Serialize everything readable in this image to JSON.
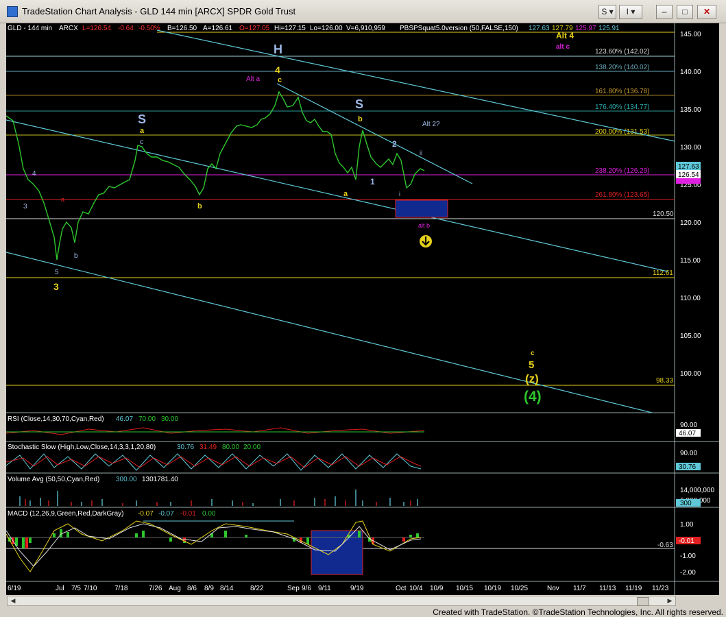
{
  "window": {
    "title": "TradeStation Chart Analysis - GLD 144 min [ARCX] SPDR Gold Trust",
    "btn_s": "S",
    "btn_i": "I"
  },
  "header": {
    "symbol": "GLD - 144 min",
    "exchange": "ARCX",
    "last": "L=126.54",
    "change": "-0.64",
    "pct": "-0.50%",
    "bid": "B=126.50",
    "ask": "A=126.61",
    "open": "O=127.05",
    "high": "Hi=127.15",
    "low": "Lo=126.00",
    "volume": "V=6,910,959",
    "indicator": "PBSPSquat5.0version (50,FALSE,150)",
    "vals": [
      "127.63",
      "127.79",
      "125.97",
      "125.91"
    ]
  },
  "price_axis": {
    "labels": [
      "145.00",
      "140.00",
      "135.00",
      "130.00",
      "125.00",
      "120.00",
      "115.00",
      "110.00",
      "105.00",
      "100.00"
    ]
  },
  "last_price_tags": {
    "top": "127.63",
    "last": "126.54",
    "under": "125.97"
  },
  "fib_levels": [
    "123.60% (142.02)",
    "138.20% (140.02)",
    "161.80% (136.78)",
    "176.40% (134.77)",
    "200.00% (131.53)",
    "238.20% (126.29)",
    "261.80% (123.65)"
  ],
  "levels": [
    "120.50",
    "112.61",
    "98.33"
  ],
  "wave_labels": {
    "H": "H",
    "four": "4",
    "c_top": "c",
    "alt_a": "Alt a",
    "S_left": "S",
    "a_left": "a",
    "c_left": "c",
    "S_right": "S",
    "b_right": "b",
    "two": "2",
    "alt2": "Alt 2?",
    "ii": "ii",
    "one": "1",
    "i_low": "i",
    "a_right": "a",
    "b_left": "b",
    "four_small": "4",
    "three_small": "3",
    "a_small": "a",
    "b_small": "b",
    "five_small": "5",
    "three_big": "3",
    "alt4": "Alt 4",
    "alt_c": "alt c",
    "alt_b": "alt b",
    "c_bottom": "c",
    "five_bottom": "5",
    "z": "(z)",
    "four_big": "(4)"
  },
  "panes": {
    "rsi": {
      "label": "RSI (Close,14,30,70,Cyan,Red)",
      "v1": "46.07",
      "v2": "70.00",
      "v3": "30.00",
      "axis": "90.00",
      "tag": "46.07"
    },
    "stoch": {
      "label": "Stochastic Slow (High,Low,Close,14,3,3,1,20,80)",
      "v1": "30.76",
      "v2": "31.49",
      "v3": "80.00",
      "v4": "20.00",
      "axis": "90.00",
      "tag": "30.76"
    },
    "volume": {
      "label": "Volume Avg (50,50,Cyan,Red)",
      "v1": "300.00",
      "v2": "1301781.40",
      "axis1": "14,000,000",
      "axis2": "6,000,000",
      "tag": "300"
    },
    "macd": {
      "label": "MACD (12,26,9,Green,Red,DarkGray)",
      "v1": "-0.07",
      "v2": "-0.07",
      "v3": "-0.01",
      "v4": "0.00",
      "axis": [
        "1.00",
        "-1.00",
        "-2.00"
      ],
      "level": "-0.63",
      "tag": "-0.01"
    }
  },
  "date_axis": [
    "6/19",
    "Jul",
    "7/5",
    "7/10",
    "7/18",
    "7/26",
    "Aug",
    "8/6",
    "8/9",
    "8/14",
    "8/22",
    "Sep",
    "9/6",
    "9/11",
    "9/19",
    "Oct",
    "10/4",
    "10/9",
    "10/15",
    "10/19",
    "10/25",
    "Nov",
    "11/7",
    "11/13",
    "11/19",
    "11/23"
  ],
  "footer": "Created with TradeStation. ©TradeStation Technologies, Inc. All rights reserved.",
  "colors": {
    "background": "#000000",
    "cyan": "#5fc8d8",
    "yellow": "#e6d11a",
    "magenta": "#e020e0",
    "red": "#e02020",
    "green": "#2ec72e"
  }
}
